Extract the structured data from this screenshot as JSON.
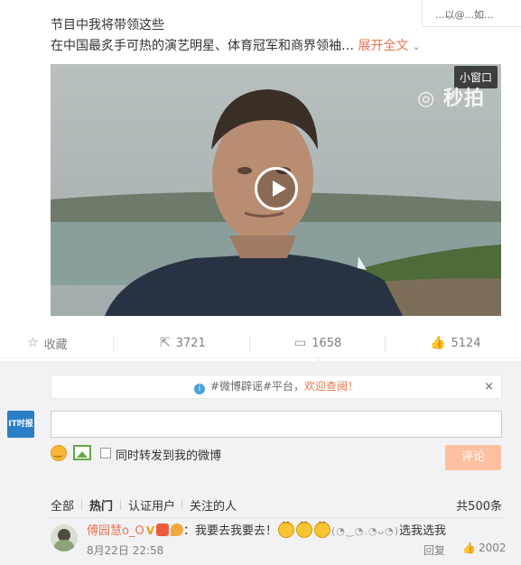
{
  "top_corner": {
    "text": "...以@...如..."
  },
  "post": {
    "line1": "节目中我将带领这些",
    "line2_text": "在中国最炙手可热的演艺明星、体育冠军和商界领袖…",
    "expand_label": "展开全文",
    "expand_chevron": "⌄"
  },
  "video": {
    "mini_window_label": "小窗口",
    "watermark": "◎ 秒拍"
  },
  "actions": {
    "favorite": {
      "icon": "☆",
      "label": "收藏"
    },
    "forward": {
      "icon": "⇱",
      "count": "3721"
    },
    "comment": {
      "icon": "▭",
      "count": "1658"
    },
    "like": {
      "icon": "👍",
      "count": "5124"
    }
  },
  "notice": {
    "icon": "i",
    "prefix": "#微博辟谣#平台，",
    "link": "欢迎查阅！",
    "close": "×"
  },
  "composer": {
    "avatar_text": "IT时报",
    "input_placeholder": "",
    "checkbox_label": "同时转发到我的微博",
    "submit_label": "评论"
  },
  "filters": {
    "all": "全部",
    "hot": "热门",
    "verified": "认证用户",
    "following": "关注的人",
    "total": "共500条"
  },
  "comments": [
    {
      "user": "傅园慧o_O",
      "vbadge": "V",
      "text_prefix": "：我要去我要去！",
      "eyes": "(◔‿◔.◔ᴗ◔)",
      "text_suffix": "选我选我",
      "time": "8月22日 22:58",
      "reply_label": "回复",
      "like_icon": "👍",
      "like_count": "2002"
    }
  ]
}
